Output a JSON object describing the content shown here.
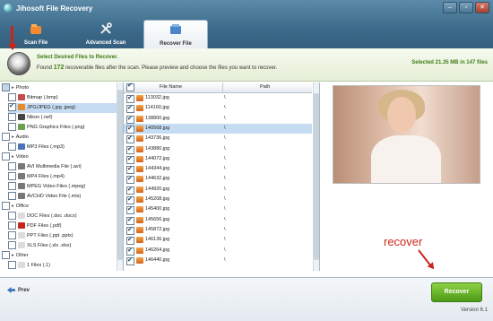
{
  "app": {
    "title": "Jihosoft File Recovery"
  },
  "window_buttons": {
    "minimize": "–",
    "maximize": "▫",
    "close": "✕"
  },
  "tabs": [
    {
      "label": "Scan File",
      "active": false
    },
    {
      "label": "Advanced Scan",
      "active": false
    },
    {
      "label": "Recover File",
      "active": true
    }
  ],
  "info": {
    "title": "Select Desired Files to Recover.",
    "found_prefix": "Found",
    "found_count": "172",
    "found_suffix": "recoverable files after the scan. Please preview and choose the files you want to recover.",
    "selected": "Selected 21.35 MB in 147 files"
  },
  "tree": [
    {
      "label": "Photo",
      "level": 0,
      "state": "part"
    },
    {
      "label": "Bitmap (.bmp)",
      "level": 1,
      "state": "off",
      "color": "#c84b4b"
    },
    {
      "label": "JPG/JPEG (.jpg .jpeg)",
      "level": 1,
      "state": "on",
      "color": "#e58b2c",
      "selected": true
    },
    {
      "label": "Nikon (.nef)",
      "level": 1,
      "state": "off",
      "color": "#444"
    },
    {
      "label": "PNG Graphics Files (.png)",
      "level": 1,
      "state": "off",
      "color": "#6aa14a"
    },
    {
      "label": "Audio",
      "level": 0,
      "state": "off"
    },
    {
      "label": "MP3 Files (.mp3)",
      "level": 1,
      "state": "off",
      "color": "#4a73b8"
    },
    {
      "label": "Video",
      "level": 0,
      "state": "off"
    },
    {
      "label": "AVI Multimedia File (.avi)",
      "level": 1,
      "state": "off",
      "color": "#777"
    },
    {
      "label": "MP4 Files (.mp4)",
      "level": 1,
      "state": "off",
      "color": "#777"
    },
    {
      "label": "MPEG Video Files (.mpeg)",
      "level": 1,
      "state": "off",
      "color": "#777"
    },
    {
      "label": "AVCHD Video File (.mts)",
      "level": 1,
      "state": "off",
      "color": "#777"
    },
    {
      "label": "Office",
      "level": 0,
      "state": "off"
    },
    {
      "label": "DOC Files (.doc .docx)",
      "level": 1,
      "state": "off",
      "color": "#dcdcdc"
    },
    {
      "label": "PDF Files (.pdf)",
      "level": 1,
      "state": "off",
      "color": "#c8261b"
    },
    {
      "label": "PPT Files (.ppt .pptx)",
      "level": 1,
      "state": "off",
      "color": "#dcdcdc"
    },
    {
      "label": "XLS Files (.xls .xlsx)",
      "level": 1,
      "state": "off",
      "color": "#dcdcdc"
    },
    {
      "label": "Other",
      "level": 0,
      "state": "off"
    },
    {
      "label": "1 Files (.1)",
      "level": 1,
      "state": "off",
      "color": "#dcdcdc"
    }
  ],
  "grid": {
    "col_name": "File Name",
    "col_path": "Path",
    "rows": [
      {
        "name": "113032.jpg",
        "path": "\\"
      },
      {
        "name": "114160.jpg",
        "path": "\\"
      },
      {
        "name": "138800.jpg",
        "path": "\\"
      },
      {
        "name": "140568.jpg",
        "path": "\\",
        "selected": true
      },
      {
        "name": "143736.jpg",
        "path": "\\"
      },
      {
        "name": "143880.jpg",
        "path": "\\"
      },
      {
        "name": "144072.jpg",
        "path": "\\"
      },
      {
        "name": "144344.jpg",
        "path": "\\"
      },
      {
        "name": "144632.jpg",
        "path": "\\"
      },
      {
        "name": "144920.jpg",
        "path": "\\"
      },
      {
        "name": "145208.jpg",
        "path": "\\"
      },
      {
        "name": "145400.jpg",
        "path": "\\"
      },
      {
        "name": "145656.jpg",
        "path": "\\"
      },
      {
        "name": "145872.jpg",
        "path": "\\"
      },
      {
        "name": "146136.jpg",
        "path": "\\"
      },
      {
        "name": "146264.jpg",
        "path": "\\"
      },
      {
        "name": "146440.jpg",
        "path": "\\"
      }
    ]
  },
  "annotation": {
    "text": "recover"
  },
  "bottom": {
    "prev": "Prev",
    "recover": "Recover",
    "version": "Version 6.1"
  }
}
